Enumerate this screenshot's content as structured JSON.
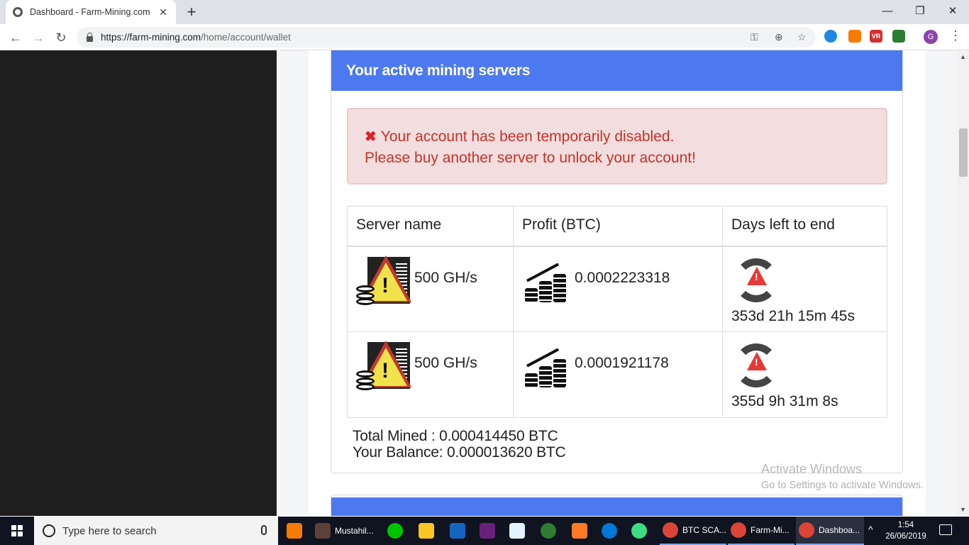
{
  "browser": {
    "tab_title": "Dashboard - Farm-Mining.com",
    "url_host": "https://farm-mining.com",
    "url_path": "/home/account/wallet",
    "profile_initial": "G",
    "ext_labels": [
      "",
      "",
      "VR",
      ""
    ]
  },
  "panel": {
    "title": "Your active mining servers",
    "alert_line1": "Your account has been temporarily disabled.",
    "alert_line2": "Please buy another server to unlock your account!",
    "headers": [
      "Server name",
      "Profit (BTC)",
      "Days left to end"
    ],
    "rows": [
      {
        "server": "500 GH/s",
        "profit": "0.0002223318",
        "days_left": "353d 21h 15m 45s"
      },
      {
        "server": "500 GH/s",
        "profit": "0.0001921178",
        "days_left": "355d 9h 31m 8s"
      }
    ],
    "total_mined": "Total Mined : 0.000414450 BTC",
    "balance": "Your Balance: 0.000013620 BTC"
  },
  "watermark": {
    "line1": "Activate Windows",
    "line2": "Go to Settings to activate Windows."
  },
  "taskbar": {
    "search_placeholder": "Type here to search",
    "items": [
      "Mustahil...",
      "BTC SCA...",
      "Farm-Mi...",
      "Dashboa..."
    ],
    "time": "1:54",
    "date": "26/06/2019"
  },
  "colors": {
    "header_blue": "#4d79f0",
    "alert_bg": "#f2dede",
    "alert_text": "#c9302c",
    "warning_red": "#e53935"
  }
}
